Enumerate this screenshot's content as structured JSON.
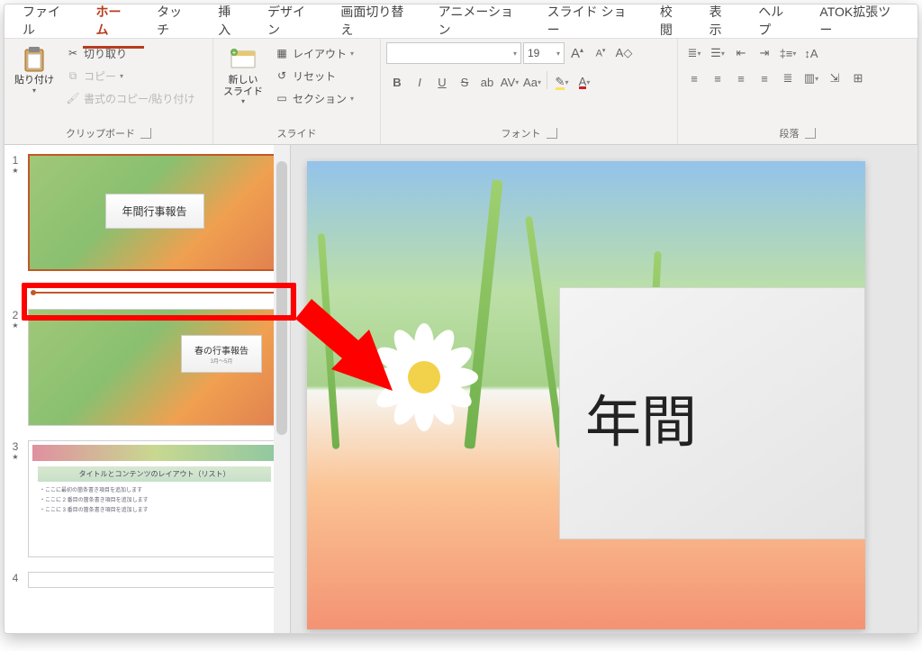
{
  "tabs": {
    "file": "ファイル",
    "home": "ホーム",
    "touch": "タッチ",
    "insert": "挿入",
    "design": "デザイン",
    "transitions": "画面切り替え",
    "animations": "アニメーション",
    "slideshow": "スライド ショー",
    "review": "校閲",
    "view": "表示",
    "help": "ヘルプ",
    "atok": "ATOK拡張ツー"
  },
  "ribbon": {
    "clipboard": {
      "paste": "貼り付け",
      "cut": "切り取り",
      "copy": "コピー",
      "format_painter": "書式のコピー/貼り付け",
      "group_label": "クリップボード"
    },
    "slides": {
      "new_slide_l1": "新しい",
      "new_slide_l2": "スライド",
      "layout": "レイアウト",
      "reset": "リセット",
      "section": "セクション",
      "group_label": "スライド"
    },
    "font": {
      "size_value": "19",
      "group_label": "フォント"
    },
    "paragraph": {
      "group_label": "段落"
    }
  },
  "thumbnails": {
    "slide1": {
      "num": "1",
      "title": "年間行事報告"
    },
    "slide2": {
      "num": "2",
      "title": "春の行事報告",
      "sub": "3月～5月"
    },
    "slide3": {
      "num": "3",
      "heading": "タイトルとコンテンツのレイアウト（リスト）",
      "b1": "・ここに最初の箇条書き項目を追加します",
      "b2": "・ここに 2 番目の箇条書き項目を追加します",
      "b3": "・ここに 3 番目の箇条書き項目を追加します"
    },
    "slide4": {
      "num": "4"
    }
  },
  "slide_canvas": {
    "title": "年間"
  }
}
